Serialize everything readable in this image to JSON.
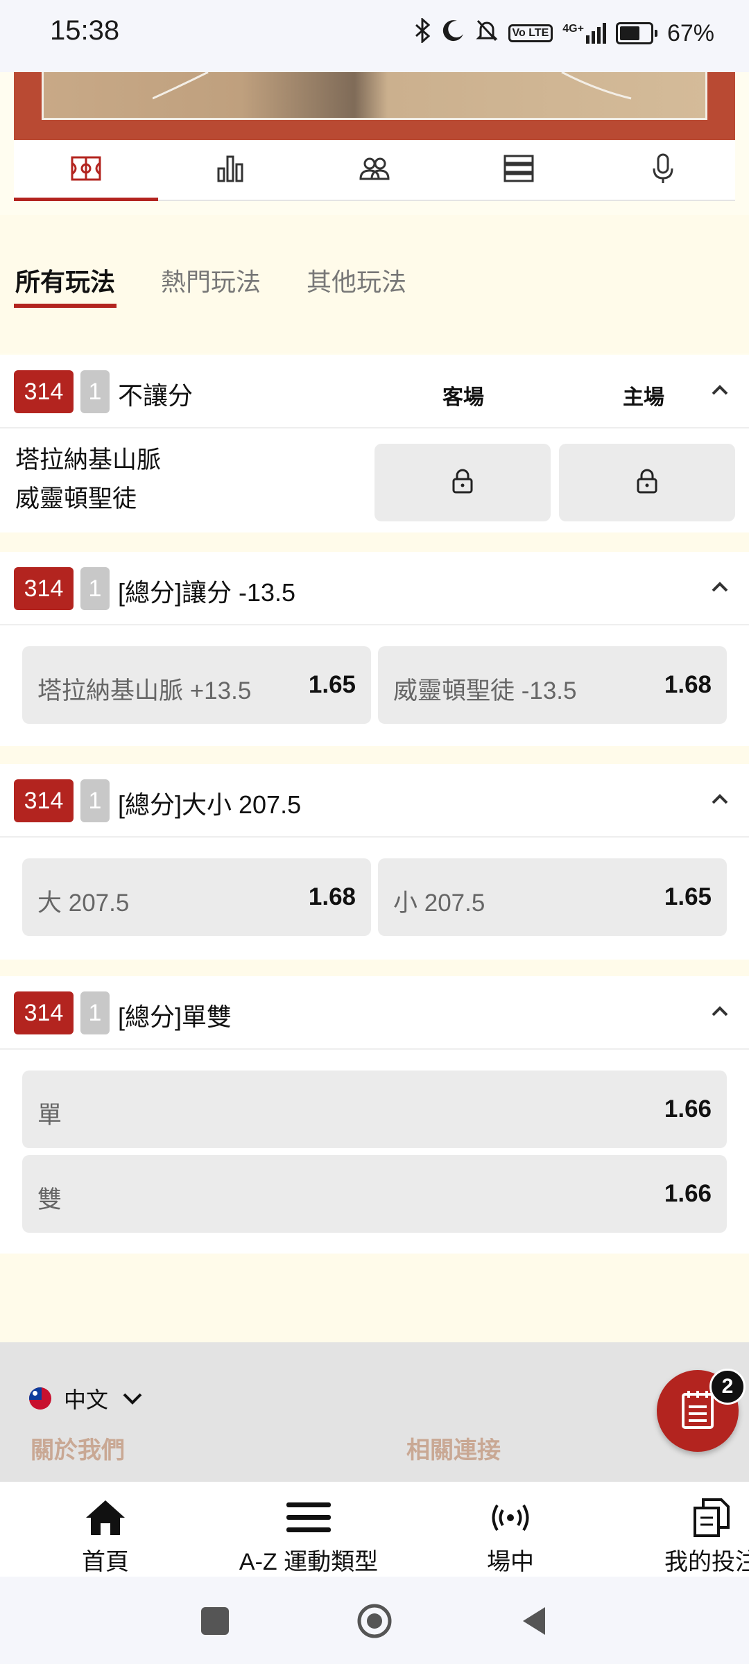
{
  "status_bar": {
    "time": "15:38",
    "network": "4G+",
    "volte": "Vo LTE",
    "battery": "67%",
    "battery_level": 0.67
  },
  "sport_tabs": [
    {
      "name": "basketball-court-icon",
      "active": true
    },
    {
      "name": "stats-chart-icon",
      "active": false
    },
    {
      "name": "lineup-users-icon",
      "active": false
    },
    {
      "name": "standings-list-icon",
      "active": false
    },
    {
      "name": "microphone-icon",
      "active": false
    }
  ],
  "play_tabs": {
    "all": "所有玩法",
    "popular": "熱門玩法",
    "other": "其他玩法"
  },
  "markets": {
    "moneyline": {
      "code": "314",
      "period": "1",
      "title": "不讓分",
      "away_label": "客場",
      "home_label": "主場",
      "team_away": "塔拉納基山脈",
      "team_home": "威靈頓聖徒"
    },
    "handicap": {
      "code": "314",
      "period": "1",
      "title": "[總分]讓分 -13.5",
      "options": [
        {
          "label": "塔拉納基山脈 +13.5",
          "odds": "1.65"
        },
        {
          "label": "威靈頓聖徒 -13.5",
          "odds": "1.68"
        }
      ]
    },
    "total": {
      "code": "314",
      "period": "1",
      "title": "[總分]大小 207.5",
      "options": [
        {
          "label": "大 207.5",
          "odds": "1.68"
        },
        {
          "label": "小 207.5",
          "odds": "1.65"
        }
      ]
    },
    "odd_even": {
      "code": "314",
      "period": "1",
      "title": "[總分]單雙",
      "options": [
        {
          "label": "單",
          "odds": "1.66"
        },
        {
          "label": "雙",
          "odds": "1.66"
        }
      ]
    }
  },
  "footer": {
    "language": "中文",
    "about": "關於我們",
    "links": "相關連接",
    "betslip_count": "2"
  },
  "bottom_nav": {
    "home": "首頁",
    "az": "A-Z 運動類型",
    "live": "場中",
    "mybets": "我的投注"
  },
  "colors": {
    "accent": "#b3241f",
    "panel": "#fffbea",
    "button": "#ebebeb"
  }
}
